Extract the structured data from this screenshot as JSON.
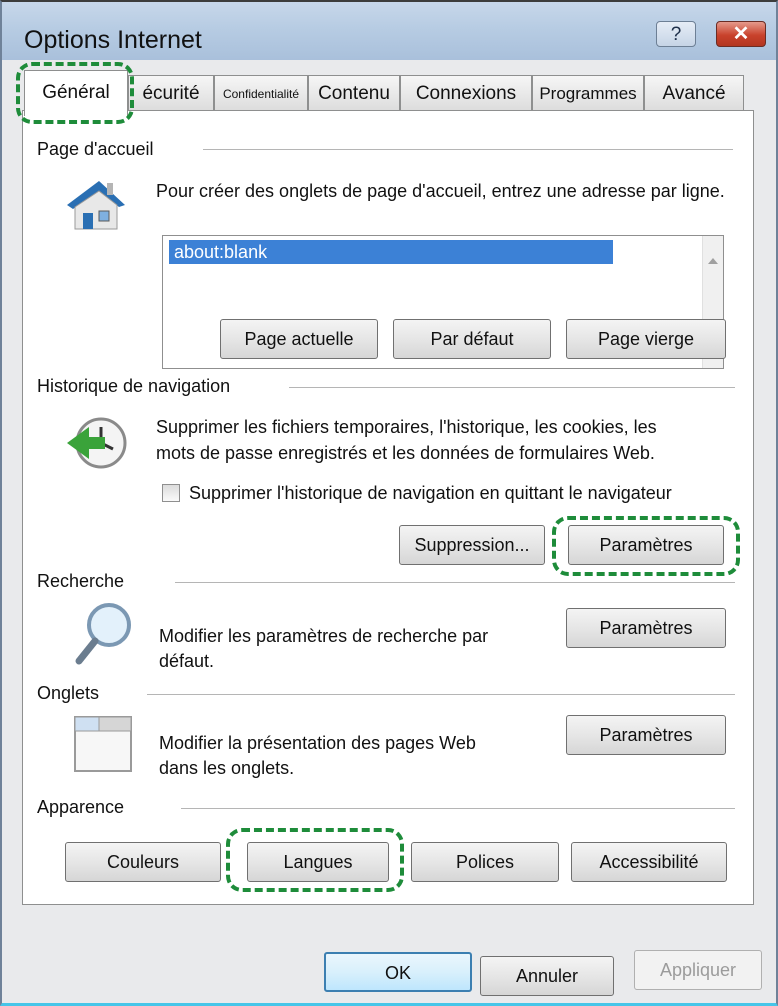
{
  "window": {
    "title": "Options Internet",
    "help_glyph": "?",
    "close_glyph": "✕"
  },
  "tabs": [
    {
      "label": "Général",
      "active": true
    },
    {
      "label": "écurité"
    },
    {
      "label": "Confidentialité"
    },
    {
      "label": "Contenu"
    },
    {
      "label": "Connexions"
    },
    {
      "label": "Programmes"
    },
    {
      "label": "Avancé"
    }
  ],
  "homepage": {
    "legend": "Page d'accueil",
    "instruction": "Pour créer des onglets de page d'accueil, entrez une adresse par ligne.",
    "url_value": "about:blank",
    "buttons": {
      "current": "Page actuelle",
      "default": "Par défaut",
      "blank": "Page vierge"
    },
    "icon": "house-icon"
  },
  "history": {
    "legend": "Historique de navigation",
    "description_line1": "Supprimer les fichiers temporaires, l'historique, les cookies, les",
    "description_line2": "mots de passe enregistrés et les données de formulaires Web.",
    "checkbox_label": "Supprimer l'historique de navigation en quittant le navigateur",
    "checkbox_checked": false,
    "delete_button": "Suppression...",
    "settings_button": "Paramètres",
    "icon": "history-clock-icon"
  },
  "search": {
    "legend": "Recherche",
    "description_line1": "Modifier les paramètres de recherche par",
    "description_line2": "défaut.",
    "settings_button": "Paramètres",
    "icon": "magnifier-icon"
  },
  "tabs_group": {
    "legend": "Onglets",
    "description_line1": "Modifier la présentation des pages Web",
    "description_line2": "dans les onglets.",
    "settings_button": "Paramètres",
    "icon": "tabs-window-icon"
  },
  "appearance": {
    "legend": "Apparence",
    "colors_button": "Couleurs",
    "languages_button": "Langues",
    "fonts_button": "Polices",
    "accessibility_button": "Accessibilité"
  },
  "footer": {
    "ok": "OK",
    "cancel": "Annuler",
    "apply": "Appliquer"
  },
  "colors": {
    "highlight": "#1e8c3a",
    "selection": "#3c81d6",
    "titlebar": "#b7cce3"
  }
}
